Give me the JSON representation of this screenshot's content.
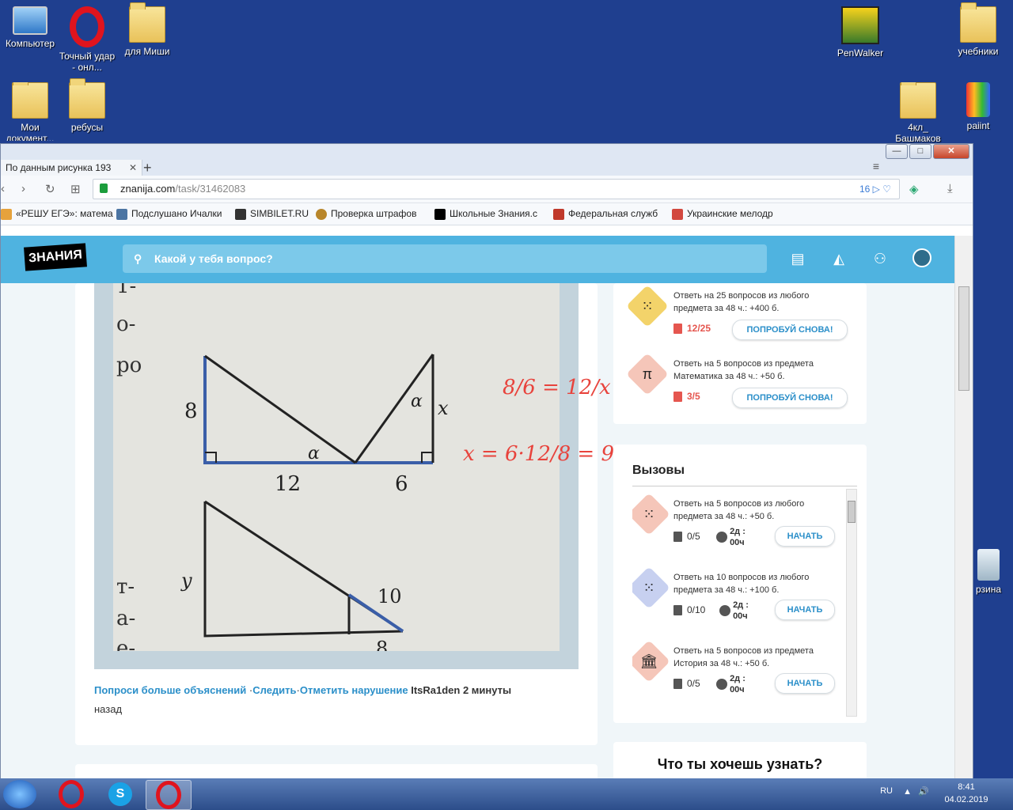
{
  "desktop": {
    "icons": [
      {
        "label": "Компьютер"
      },
      {
        "label": "Точный удар - онл..."
      },
      {
        "label": "для Миши"
      },
      {
        "label": "PenWalker"
      },
      {
        "label": "учебники"
      },
      {
        "label": "Мои документ..."
      },
      {
        "label": "ребусы"
      },
      {
        "label": "4кл_ Башмаков"
      },
      {
        "label": "paiint"
      },
      {
        "label": "рзина"
      }
    ]
  },
  "browser": {
    "tab_title": "По данным рисунка 193",
    "new_tab": "+",
    "url_host": "znanija.com",
    "url_path": "/task/31462083",
    "adblock_count": "16",
    "bookmarks": [
      "«РЕШУ ЕГЭ»: матема",
      "Подслушано Ичалки",
      "SIMBILET.RU",
      "Проверка штрафов",
      "Школьные Знания.c",
      "Федеральная служб",
      "Украинские мелодр"
    ]
  },
  "site": {
    "logo": "ЗНАНИЯ",
    "search_placeholder": "Какой у тебя вопрос?"
  },
  "image": {
    "side_labels": [
      "1-",
      "о-",
      "ро",
      "т-",
      "а-",
      "е-"
    ],
    "fig1": {
      "left_side": "8",
      "bottom1": "12",
      "bottom2": "6",
      "angle": "α",
      "right_side": "x"
    },
    "fig2": {
      "left_side": "y",
      "hyp": "10",
      "bottom": "8"
    },
    "handwritten": {
      "line1": "8/6 = 12/x",
      "line2": "x = 6·12/8 = 9"
    }
  },
  "answer_meta": {
    "ask_more": "Попроси больше объяснений",
    "follow": "Следить",
    "report": "Отметить нарушение",
    "user": "ItsRa1den",
    "time": "2 минуты",
    "ago": "назад"
  },
  "quests": [
    {
      "text": "Ответь на 25 вопросов из любого предмета за 48 ч.: +400 б.",
      "progress": "12/25",
      "button": "ПОПРОБУЙ СНОВА!",
      "icon": "dots-icon",
      "color": "#f3d36a"
    },
    {
      "text": "Ответь на 5 вопросов из предмета Математика за 48 ч.: +50 б.",
      "progress": "3/5",
      "button": "ПОПРОБУЙ СНОВА!",
      "icon": "π",
      "color": "#f5c6b9"
    }
  ],
  "challenges": {
    "title": "Вызовы",
    "items": [
      {
        "text": "Ответь на 5 вопросов из любого предмета за 48 ч.: +50 б.",
        "progress": "0/5",
        "time": "2д : 00ч",
        "button": "НАЧАТЬ",
        "color": "#f5c6b9"
      },
      {
        "text": "Ответь на 10 вопросов из любого предмета за 48 ч.: +100 б.",
        "progress": "0/10",
        "time": "2д : 00ч",
        "button": "НАЧАТЬ",
        "color": "#c7d0f0"
      },
      {
        "text": "Ответь на 5 вопросов из предмета История за 48 ч.: +50 б.",
        "progress": "0/5",
        "time": "2д : 00ч",
        "button": "НАЧАТЬ",
        "color": "#f5c6b9"
      }
    ]
  },
  "bottom_card_title": "Что ты хочешь узнать?",
  "tray": {
    "lang": "RU",
    "time": "8:41",
    "date": "04.02.2019"
  }
}
